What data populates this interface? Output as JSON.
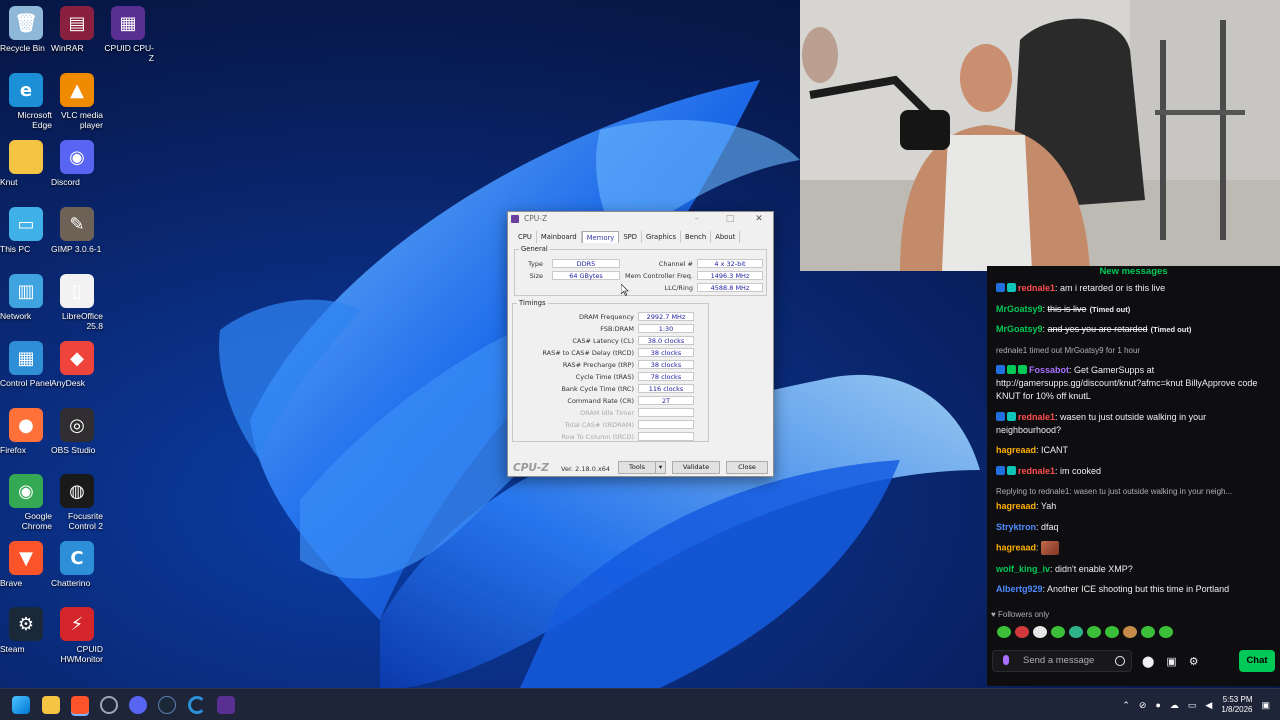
{
  "desktop": {
    "icons": [
      {
        "label": "Recycle Bin",
        "icon": "recycle-bin-icon",
        "color": "#8fb7d8",
        "glyph": "🗑"
      },
      {
        "label": "WinRAR",
        "icon": "winrar-icon",
        "color": "#8a2040",
        "glyph": "▤"
      },
      {
        "label": "CPUID CPU-Z",
        "icon": "cpuz-icon",
        "color": "#5a2f92",
        "glyph": "▦"
      },
      {
        "label": "Microsoft Edge",
        "icon": "edge-icon",
        "color": "#1d8fd6",
        "glyph": "e"
      },
      {
        "label": "VLC media player",
        "icon": "vlc-icon",
        "color": "#f08a00",
        "glyph": "▲"
      },
      {
        "label": "Knut",
        "icon": "folder-icon",
        "color": "#f6c443",
        "glyph": ""
      },
      {
        "label": "Discord",
        "icon": "discord-icon",
        "color": "#5865f2",
        "glyph": "◉"
      },
      {
        "label": "This PC",
        "icon": "this-pc-icon",
        "color": "#3fb1e8",
        "glyph": "▭"
      },
      {
        "label": "GIMP 3.0.6-1",
        "icon": "gimp-icon",
        "color": "#6e6257",
        "glyph": "✎"
      },
      {
        "label": "Network",
        "icon": "network-icon",
        "color": "#3fa3e0",
        "glyph": "▥"
      },
      {
        "label": "LibreOffice 25.8",
        "icon": "libreoffice-icon",
        "color": "#f2f2f2",
        "glyph": "▯"
      },
      {
        "label": "Control Panel",
        "icon": "control-panel-icon",
        "color": "#2f8fd6",
        "glyph": "▦"
      },
      {
        "label": "AnyDesk",
        "icon": "anydesk-icon",
        "color": "#ef443b",
        "glyph": "◆"
      },
      {
        "label": "Firefox",
        "icon": "firefox-icon",
        "color": "#ff7139",
        "glyph": "●"
      },
      {
        "label": "OBS Studio",
        "icon": "obs-icon",
        "color": "#302e31",
        "glyph": "◎"
      },
      {
        "label": "Google Chrome",
        "icon": "chrome-icon",
        "color": "#34a853",
        "glyph": "◉"
      },
      {
        "label": "Focusrite Control 2",
        "icon": "focusrite-icon",
        "color": "#1a1a1a",
        "glyph": "◍"
      },
      {
        "label": "Brave",
        "icon": "brave-icon",
        "color": "#fb542b",
        "glyph": "▼"
      },
      {
        "label": "Chatterino",
        "icon": "chatterino-icon",
        "color": "#2c8fd8",
        "glyph": "C"
      },
      {
        "label": "Steam",
        "icon": "steam-icon",
        "color": "#1b2838",
        "glyph": "⚙"
      },
      {
        "label": "CPUID HWMonitor",
        "icon": "hwmonitor-icon",
        "color": "#d4252b",
        "glyph": "⚡"
      }
    ]
  },
  "cpuz": {
    "title": "CPU-Z",
    "tabs": [
      "CPU",
      "Mainboard",
      "Memory",
      "SPD",
      "Graphics",
      "Bench",
      "About"
    ],
    "active_tab": "Memory",
    "general": {
      "group_title": "General",
      "type_label": "Type",
      "type_value": "DDR5",
      "size_label": "Size",
      "size_value": "64 GBytes",
      "channel_label": "Channel #",
      "channel_value": "4 x 32-bit",
      "memctrl_label": "Mem Controller Freq.",
      "memctrl_value": "1496.3 MHz",
      "llc_label": "LLC/Ring",
      "llc_value": "4588.8 MHz"
    },
    "timings": {
      "group_title": "Timings",
      "rows": [
        {
          "label": "DRAM Frequency",
          "value": "2992.7 MHz",
          "dim": false
        },
        {
          "label": "FSB:DRAM",
          "value": "1:30",
          "dim": false
        },
        {
          "label": "CAS# Latency (CL)",
          "value": "38.0 clocks",
          "dim": false
        },
        {
          "label": "RAS# to CAS# Delay (tRCD)",
          "value": "38 clocks",
          "dim": false
        },
        {
          "label": "RAS# Precharge (tRP)",
          "value": "38 clocks",
          "dim": false
        },
        {
          "label": "Cycle Time (tRAS)",
          "value": "78 clocks",
          "dim": false
        },
        {
          "label": "Bank Cycle Time (tRC)",
          "value": "116 clocks",
          "dim": false
        },
        {
          "label": "Command Rate (CR)",
          "value": "2T",
          "dim": false
        },
        {
          "label": "DRAM Idle Timer",
          "value": "",
          "dim": true
        },
        {
          "label": "Total CAS# (tRDRAM)",
          "value": "",
          "dim": true
        },
        {
          "label": "Row To Column (tRCD)",
          "value": "",
          "dim": true
        }
      ]
    },
    "footer": {
      "brand": "CPU-Z",
      "version": "Ver. 2.18.0.x64",
      "tools": "Tools",
      "validate": "Validate",
      "close": "Close"
    }
  },
  "chat": {
    "new_messages": "New messages",
    "messages": [
      {
        "user": "rednale1",
        "color": "#ff4d4d",
        "badges": [
          "#1f6fe0",
          "#11c4b8"
        ],
        "text": "am i retarded or is this live",
        "strike": false,
        "timed": ""
      },
      {
        "user": "MrGoatsy9",
        "color": "#00c957",
        "badges": [],
        "text": "this is live",
        "strike": true,
        "timed": "(Timed out)"
      },
      {
        "user": "MrGoatsy9",
        "color": "#00c957",
        "badges": [],
        "text": "and yes you are retarded",
        "strike": true,
        "timed": "(Timed out)"
      },
      {
        "user": "Fossabot",
        "color": "#a970ff",
        "badges": [
          "#1f6fe0",
          "#00c957",
          "#00c957"
        ],
        "text": "Get GamerSupps at http://gamersupps.gg/discount/knut?afmc=knut BillyApprove code KNUT for 10% off knutL",
        "strike": false,
        "timed": ""
      },
      {
        "user": "rednale1",
        "color": "#ff4d4d",
        "badges": [
          "#1f6fe0",
          "#11c4b8"
        ],
        "text": "wasen tu just outside walking in your neighbourhood?",
        "strike": false,
        "timed": ""
      },
      {
        "user": "hagreaad",
        "color": "#ffb000",
        "badges": [],
        "text": "ICANT",
        "strike": false,
        "timed": ""
      },
      {
        "user": "rednale1",
        "color": "#ff4d4d",
        "badges": [
          "#1f6fe0",
          "#11c4b8"
        ],
        "text": "im cooked",
        "strike": false,
        "timed": ""
      },
      {
        "user": "hagreaad",
        "color": "#ffb000",
        "badges": [],
        "text": "Yah",
        "strike": false,
        "timed": ""
      },
      {
        "user": "Stryktron",
        "color": "#4d8bff",
        "badges": [],
        "text": "dfaq",
        "strike": false,
        "timed": ""
      },
      {
        "user": "hagreaad",
        "color": "#ffb000",
        "badges": [],
        "text": "",
        "strike": false,
        "timed": ""
      },
      {
        "user": "wolf_king_iv",
        "color": "#00c957",
        "badges": [],
        "text": "didn't enable XMP?",
        "strike": false,
        "timed": ""
      },
      {
        "user": "Albertg929",
        "color": "#4d8bff",
        "badges": [],
        "text": "Another ICE shooting but this time in Portland",
        "strike": false,
        "timed": ""
      }
    ],
    "timeout_notice": "rednale1 timed out MrGoatsy9 for 1 hour",
    "reply_notice": "Replying to rednale1: wasen tu just outside walking in your neigh...",
    "followers_only": "Followers only",
    "input_placeholder": "Send a message",
    "chat_button": "Chat"
  },
  "taskbar": {
    "time": "5:53 PM",
    "date": "1/8/2026"
  }
}
